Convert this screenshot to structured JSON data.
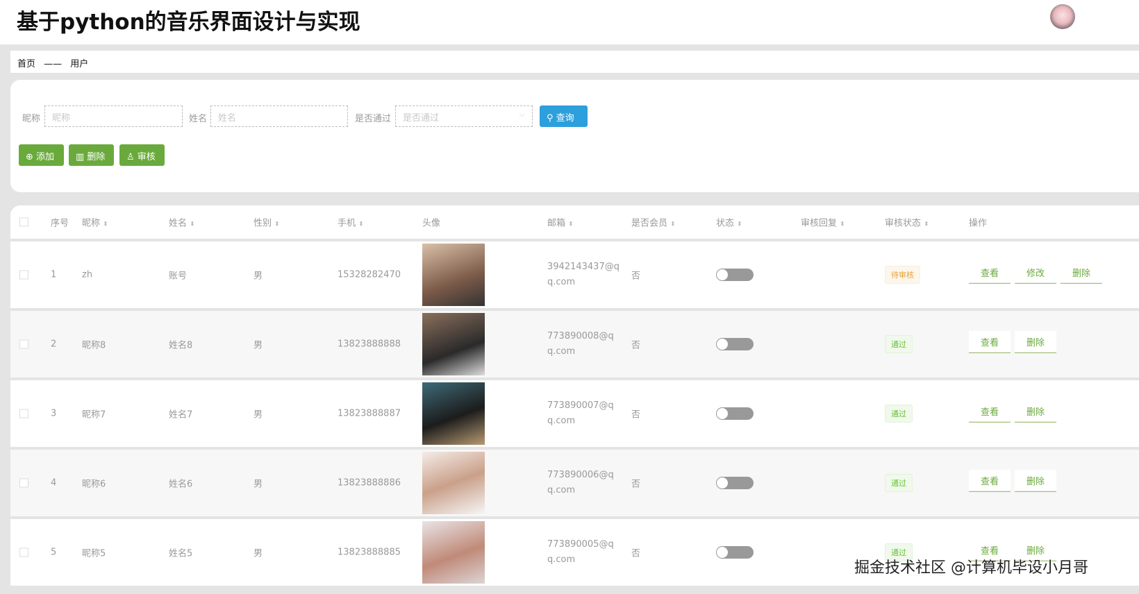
{
  "header": {
    "title": "基于python的音乐界面设计与实现"
  },
  "breadcrumb": {
    "home": "首页",
    "sep": "——",
    "current": "用户"
  },
  "search": {
    "nickname_label": "昵称",
    "nickname_placeholder": "昵称",
    "name_label": "姓名",
    "name_placeholder": "姓名",
    "pass_label": "是否通过",
    "pass_placeholder": "是否通过",
    "query_button": "查询"
  },
  "actions": {
    "add": "添加",
    "delete": "删除",
    "audit": "审核"
  },
  "columns": [
    "序号",
    "昵称",
    "姓名",
    "性别",
    "手机",
    "头像",
    "邮箱",
    "是否会员",
    "状态",
    "审核回复",
    "审核状态",
    "操作"
  ],
  "rows": [
    {
      "index": "1",
      "nickname": "zh",
      "name": "账号",
      "gender": "男",
      "phone": "15328282470",
      "email": "3942143437@qq.com",
      "member": "否",
      "reply": "",
      "audit": "待审核",
      "ops": [
        "查看",
        "修改",
        "删除"
      ]
    },
    {
      "index": "2",
      "nickname": "昵称8",
      "name": "姓名8",
      "gender": "男",
      "phone": "13823888888",
      "email": "773890008@qq.com",
      "member": "否",
      "reply": "",
      "audit": "通过",
      "ops": [
        "查看",
        "删除"
      ]
    },
    {
      "index": "3",
      "nickname": "昵称7",
      "name": "姓名7",
      "gender": "男",
      "phone": "13823888887",
      "email": "773890007@qq.com",
      "member": "否",
      "reply": "",
      "audit": "通过",
      "ops": [
        "查看",
        "删除"
      ]
    },
    {
      "index": "4",
      "nickname": "昵称6",
      "name": "姓名6",
      "gender": "男",
      "phone": "13823888886",
      "email": "773890006@qq.com",
      "member": "否",
      "reply": "",
      "audit": "通过",
      "ops": [
        "查看",
        "删除"
      ]
    },
    {
      "index": "5",
      "nickname": "昵称5",
      "name": "姓名5",
      "gender": "男",
      "phone": "13823888885",
      "email": "773890005@qq.com",
      "member": "否",
      "reply": "",
      "audit": "通过",
      "ops": [
        "查看",
        "删除"
      ]
    }
  ],
  "watermark": "掘金技术社区 @计算机毕设小月哥"
}
